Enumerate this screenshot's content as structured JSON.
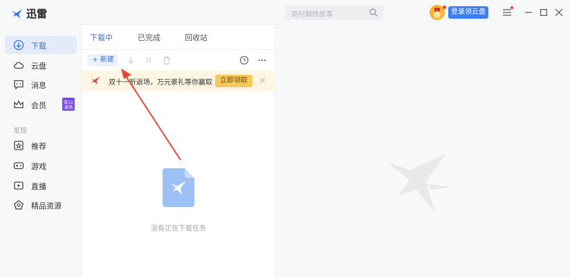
{
  "app": {
    "name": "迅雷"
  },
  "search": {
    "placeholder": "英村躺残故事"
  },
  "header": {
    "cloud_button": "登录领云盘"
  },
  "sidebar": {
    "items": [
      {
        "label": "下载",
        "icon": "download-icon",
        "active": true
      },
      {
        "label": "云盘",
        "icon": "cloud-icon"
      },
      {
        "label": "消息",
        "icon": "message-icon"
      },
      {
        "label": "会员",
        "icon": "crown-icon",
        "badge": "双十一活动"
      }
    ],
    "discover_label": "发现",
    "discover_items": [
      {
        "label": "推荐",
        "icon": "recommend-icon"
      },
      {
        "label": "游戏",
        "icon": "gamepad-icon"
      },
      {
        "label": "直播",
        "icon": "live-icon"
      },
      {
        "label": "精品资源",
        "icon": "gem-icon"
      }
    ]
  },
  "tabs": [
    {
      "label": "下载中",
      "active": true
    },
    {
      "label": "已完成"
    },
    {
      "label": "回收站"
    }
  ],
  "toolbar": {
    "new_label": "+ 新建"
  },
  "promo": {
    "text": "双十一折返场，万元豪礼等你赢取",
    "button": "立即领取"
  },
  "empty": {
    "text": "没有正在下载任务"
  },
  "colors": {
    "accent": "#2f6ef0",
    "promo_bg": "#fdf6e3",
    "badge": "#7b4ee0",
    "annotation_arrow": "#e0483c"
  }
}
